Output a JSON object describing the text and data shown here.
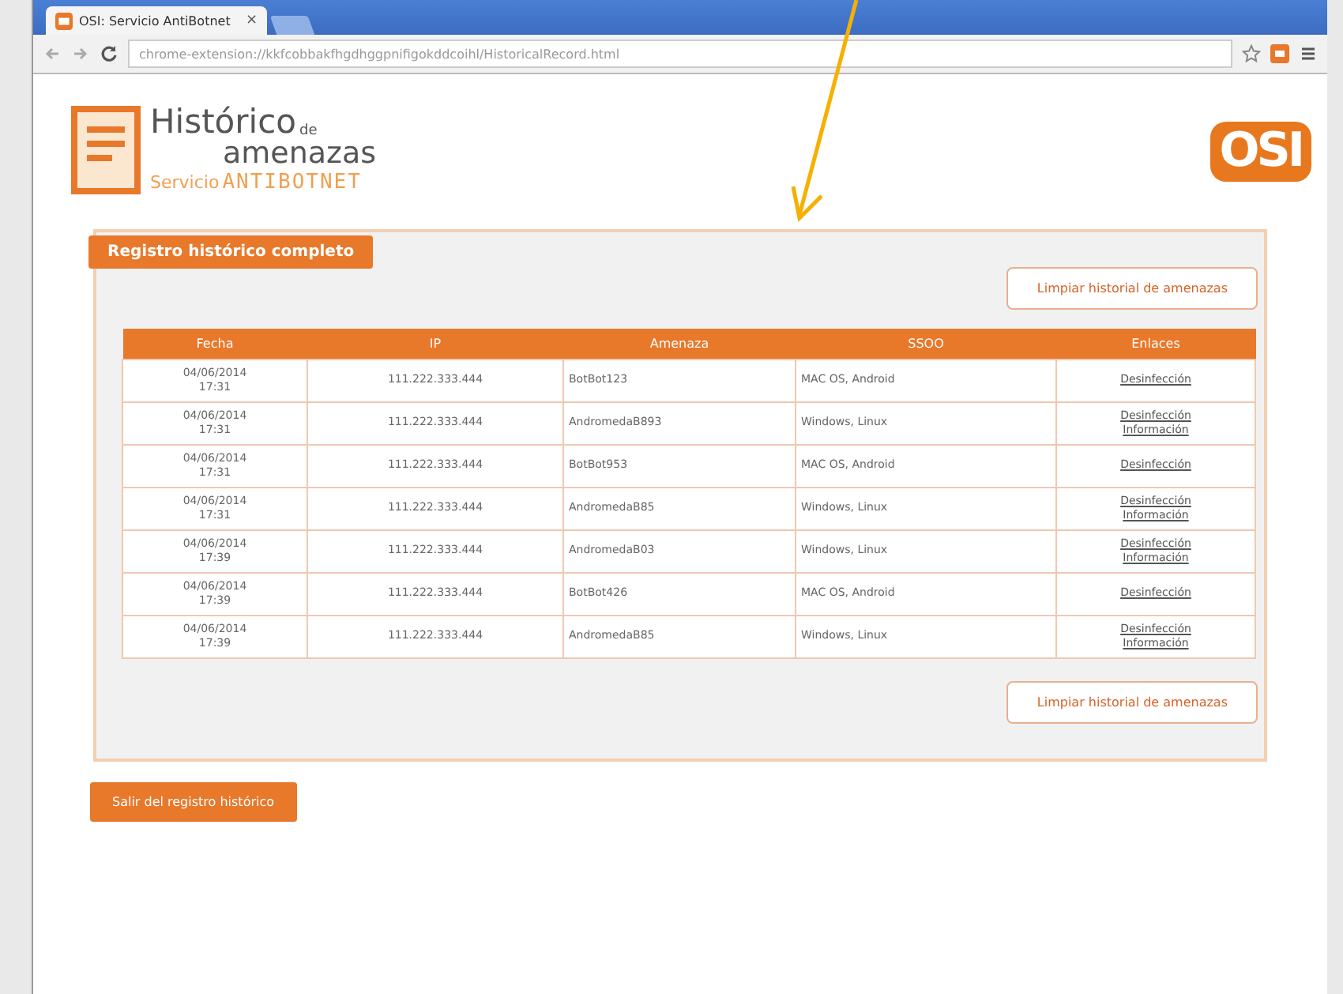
{
  "browser": {
    "tab_title": "OSI: Servicio AntiBotnet",
    "tab_close": "×",
    "url": "chrome-extension://kkfcobbakfhgdhggpnifigokddcoihl/HistoricalRecord.html"
  },
  "header": {
    "title_main": "Histórico",
    "title_de": "de",
    "title_sub": "amenazas",
    "service": "Servicio",
    "brand": "ANTIBOTNET",
    "logo_text": "OSI"
  },
  "panel": {
    "title": "Registro histórico completo",
    "clear_button_top": "Limpiar historial de amenazas",
    "clear_button_bottom": "Limpiar historial de amenazas"
  },
  "table": {
    "columns": [
      "Fecha",
      "IP",
      "Amenaza",
      "SSOO",
      "Enlaces"
    ],
    "rows": [
      {
        "date": "04/06/2014",
        "time": "17:31",
        "ip": "111.222.333.444",
        "threat": "BotBot123",
        "os": "MAC OS, Android",
        "links": [
          "Desinfección"
        ]
      },
      {
        "date": "04/06/2014",
        "time": "17:31",
        "ip": "111.222.333.444",
        "threat": "AndromedaB893",
        "os": "Windows, Linux",
        "links": [
          "Desinfección",
          "Información"
        ]
      },
      {
        "date": "04/06/2014",
        "time": "17:31",
        "ip": "111.222.333.444",
        "threat": "BotBot953",
        "os": "MAC OS, Android",
        "links": [
          "Desinfección"
        ]
      },
      {
        "date": "04/06/2014",
        "time": "17:31",
        "ip": "111.222.333.444",
        "threat": "AndromedaB85",
        "os": "Windows, Linux",
        "links": [
          "Desinfección",
          "Información"
        ]
      },
      {
        "date": "04/06/2014",
        "time": "17:39",
        "ip": "111.222.333.444",
        "threat": "AndromedaB03",
        "os": "Windows, Linux",
        "links": [
          "Desinfección",
          "Información"
        ]
      },
      {
        "date": "04/06/2014",
        "time": "17:39",
        "ip": "111.222.333.444",
        "threat": "BotBot426",
        "os": "MAC OS, Android",
        "links": [
          "Desinfección"
        ]
      },
      {
        "date": "04/06/2014",
        "time": "17:39",
        "ip": "111.222.333.444",
        "threat": "AndromedaB85",
        "os": "Windows, Linux",
        "links": [
          "Desinfección",
          "Información"
        ]
      }
    ]
  },
  "exit_button": "Salir del registro histórico"
}
